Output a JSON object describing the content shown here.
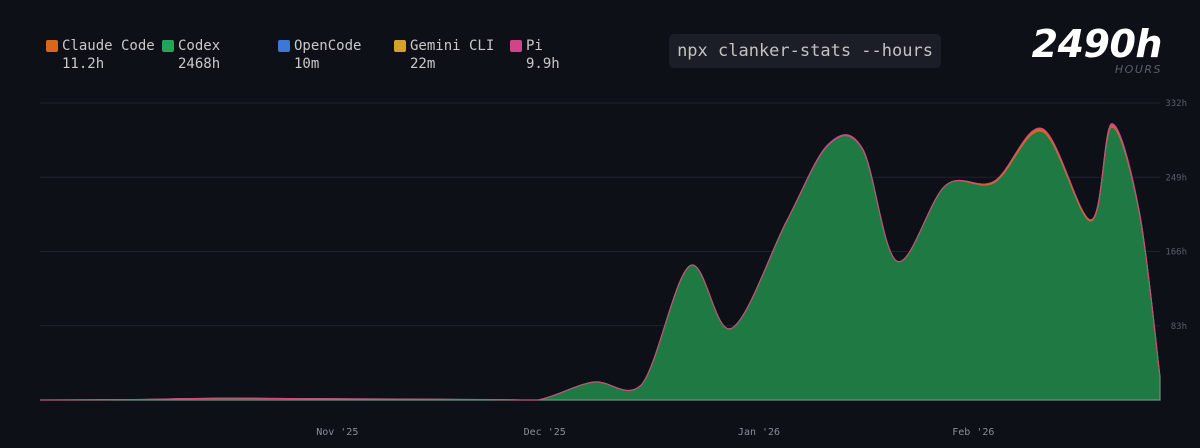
{
  "command": "npx clanker-stats --hours",
  "total": {
    "value": "2490h",
    "unit": "HOURS"
  },
  "legend": [
    {
      "name": "Claude Code",
      "value": "11.2h",
      "color": "#d9661a"
    },
    {
      "name": "Codex",
      "value": "2468h",
      "color": "#22a55a"
    },
    {
      "name": "OpenCode",
      "value": "10m",
      "color": "#3c78d8"
    },
    {
      "name": "Gemini CLI",
      "value": "22m",
      "color": "#d4a32a"
    },
    {
      "name": "Pi",
      "value": "9.9h",
      "color": "#d2448a"
    }
  ],
  "chart_data": {
    "type": "area",
    "stacked": true,
    "ylim": [
      0,
      332
    ],
    "y_ticks": [
      "83h",
      "166h",
      "249h",
      "332h"
    ],
    "y_tick_values": [
      83,
      166,
      249,
      332
    ],
    "x_ticks": [
      "Nov '25",
      "Dec '25",
      "Jan '26",
      "Feb '26"
    ],
    "x_tick_values": [
      "2025-11-01",
      "2025-12-01",
      "2026-01-01",
      "2026-02-01"
    ],
    "xlim": [
      "2025-09-19",
      "2026-02-28"
    ],
    "grid": true,
    "x": [
      "2025-09-19",
      "2025-10-02",
      "2025-10-15",
      "2025-10-28",
      "2025-11-10",
      "2025-11-23",
      "2025-11-30",
      "2025-12-08",
      "2025-12-15",
      "2025-12-22",
      "2025-12-28",
      "2026-01-05",
      "2026-01-11",
      "2026-01-16",
      "2026-01-21",
      "2026-01-28",
      "2026-02-04",
      "2026-02-11",
      "2026-02-18",
      "2026-02-21",
      "2026-02-25",
      "2026-02-28"
    ],
    "series": [
      {
        "name": "Codex",
        "color": "#1e7a42",
        "values": [
          0,
          0.5,
          2,
          1.5,
          1,
          0.5,
          0,
          20,
          17,
          150,
          80,
          200,
          285,
          280,
          155,
          240,
          243,
          300,
          200,
          305,
          210,
          26
        ]
      },
      {
        "name": "Claude Code",
        "color": "#d9661a",
        "values": [
          0,
          0,
          0,
          0,
          0,
          0,
          0,
          0,
          0,
          0,
          0,
          0,
          0,
          0,
          0,
          0,
          1.5,
          3,
          1.5,
          2,
          1,
          0.5
        ]
      },
      {
        "name": "Pi",
        "color": "#d2448a",
        "values": [
          0,
          0,
          0,
          0,
          0,
          0,
          0,
          0,
          0,
          0,
          0,
          0,
          1,
          1,
          0,
          0,
          0,
          0.5,
          0,
          2,
          1,
          0
        ]
      }
    ]
  }
}
